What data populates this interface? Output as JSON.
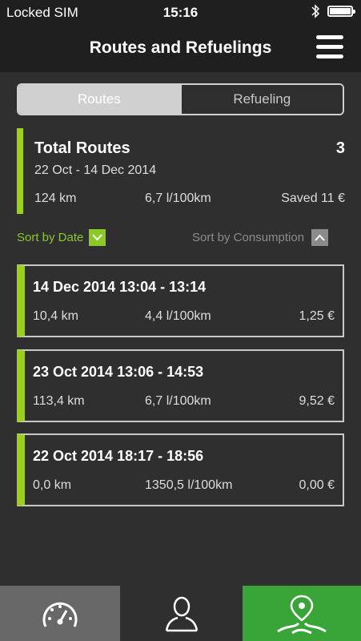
{
  "status_bar": {
    "carrier": "Locked SIM",
    "time": "15:16",
    "bluetooth_icon": "bluetooth-icon",
    "battery_icon": "battery-icon"
  },
  "header": {
    "title": "Routes and Refuelings",
    "menu_icon": "hamburger-menu-icon"
  },
  "segmented": {
    "tabs": [
      {
        "label": "Routes",
        "selected": true
      },
      {
        "label": "Refueling",
        "selected": false
      }
    ]
  },
  "summary": {
    "title": "Total Routes",
    "count": "3",
    "date_range": "22 Oct - 14 Dec 2014",
    "distance": "124 km",
    "consumption": "6,7 l/100km",
    "saved": "Saved 11 €"
  },
  "sort": {
    "by_date": "Sort by Date",
    "by_date_icon": "chevron-down-icon",
    "by_consumption": "Sort by Consumption",
    "by_consumption_icon": "chevron-up-icon"
  },
  "routes": [
    {
      "title": "14 Dec 2014 13:04 - 13:14",
      "distance": "10,4 km",
      "consumption": "4,4 l/100km",
      "cost": "1,25 €"
    },
    {
      "title": "23 Oct 2014 13:06 - 14:53",
      "distance": "113,4 km",
      "consumption": "6,7 l/100km",
      "cost": "9,52 €"
    },
    {
      "title": "22 Oct 2014 18:17 - 18:56",
      "distance": "0,0 km",
      "consumption": "1350,5 l/100km",
      "cost": "0,00 €"
    }
  ],
  "tabbar": {
    "items": [
      {
        "icon": "speedometer-icon"
      },
      {
        "icon": "person-icon"
      },
      {
        "icon": "route-map-pin-icon",
        "selected": true
      }
    ]
  },
  "colors": {
    "accent_green": "#9ccf1e",
    "sort_green": "#8ac926",
    "active_tab_green": "#39a438",
    "header_bg": "#1f1f1f",
    "body_bg": "#2f2f2f"
  }
}
